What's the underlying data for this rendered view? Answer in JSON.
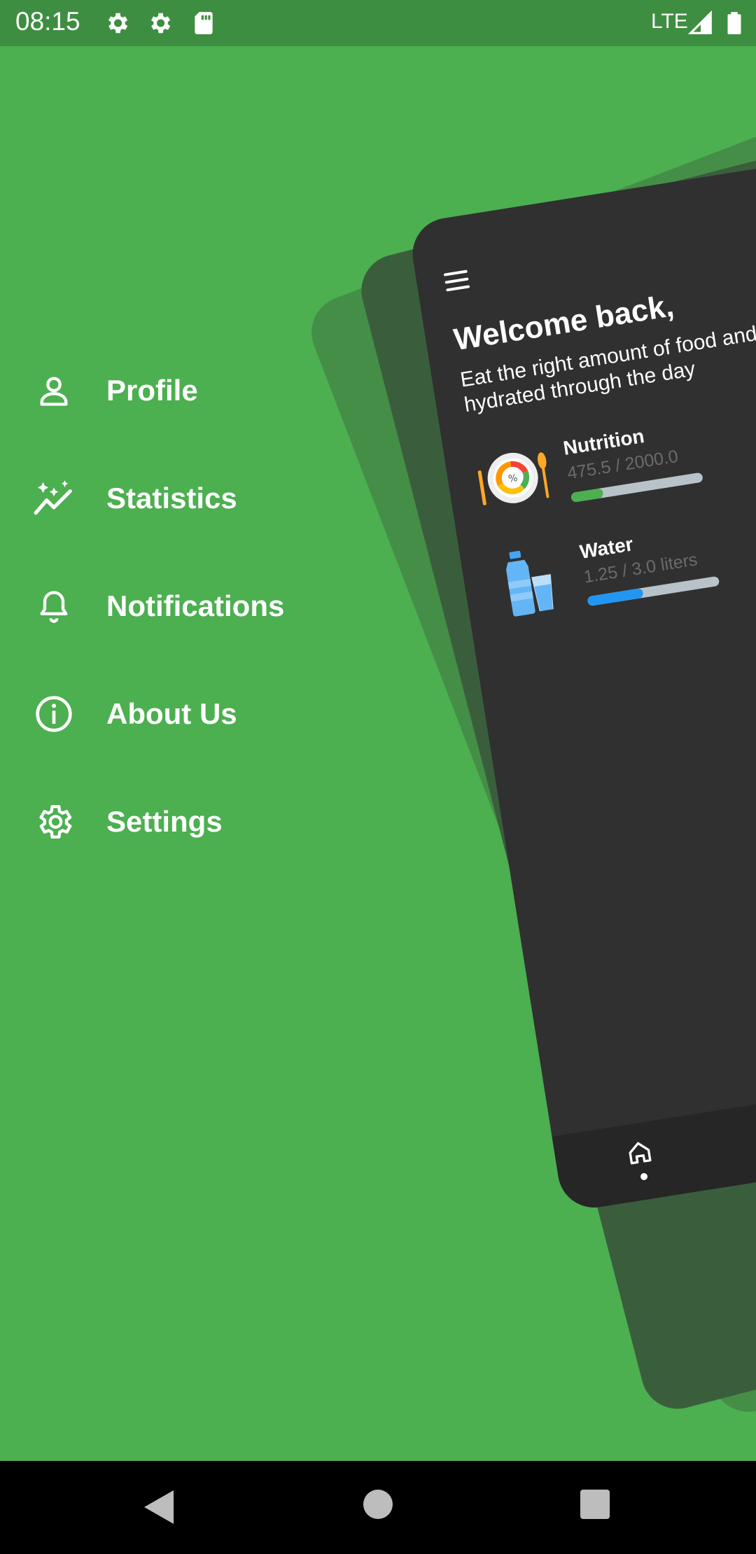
{
  "status_bar": {
    "time": "08:15",
    "icons": [
      "gear-icon",
      "gear-icon",
      "sd-card-icon"
    ],
    "network": "LTE",
    "right_icons": [
      "signal-icon",
      "battery-icon"
    ]
  },
  "menu": {
    "items": [
      {
        "label": "Profile",
        "icon": "person-icon"
      },
      {
        "label": "Statistics",
        "icon": "sparkle-chart-icon"
      },
      {
        "label": "Notifications",
        "icon": "bell-icon"
      },
      {
        "label": "About Us",
        "icon": "info-icon"
      },
      {
        "label": "Settings",
        "icon": "gear-icon"
      }
    ]
  },
  "card": {
    "welcome_title": "Welcome back,",
    "welcome_subtitle": "Eat the right amount of food and stay hydrated through the day",
    "stats": [
      {
        "name": "Nutrition",
        "value": "475.5 / 2000.0",
        "progress": 0.24,
        "color": "#4CAF50",
        "icon": "plate-icon"
      },
      {
        "name": "Water",
        "value": "1.25 / 3.0 liters",
        "progress": 0.42,
        "color": "#2196F3",
        "icon": "water-bottle-icon"
      }
    ],
    "nav": {
      "active": "home-icon"
    }
  },
  "system_nav": [
    "back-icon",
    "home-circle-icon",
    "recents-icon"
  ],
  "colors": {
    "background": "#4CAF50",
    "status_bar": "#3E8E41",
    "card": "#303030"
  }
}
